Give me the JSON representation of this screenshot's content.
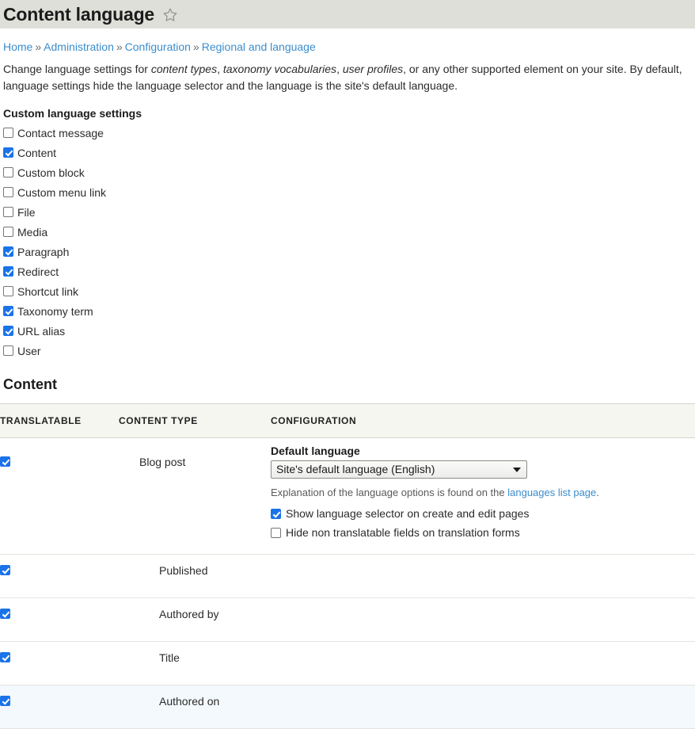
{
  "header": {
    "title": "Content language",
    "star_icon": "star-outline-icon"
  },
  "breadcrumb": {
    "separator": "»",
    "items": [
      {
        "label": "Home"
      },
      {
        "label": "Administration"
      },
      {
        "label": "Configuration"
      },
      {
        "label": "Regional and language"
      }
    ]
  },
  "intro": {
    "part1": "Change language settings for ",
    "em1": "content types",
    "part2": ", ",
    "em2": "taxonomy vocabularies",
    "part3": ", ",
    "em3": "user profiles",
    "part4": ", or any other supported element on your site. By default, language settings hide the language selector and the language is the site's default language."
  },
  "custom_language_settings": {
    "title": "Custom language settings",
    "items": [
      {
        "label": "Contact message",
        "checked": false
      },
      {
        "label": "Content",
        "checked": true
      },
      {
        "label": "Custom block",
        "checked": false
      },
      {
        "label": "Custom menu link",
        "checked": false
      },
      {
        "label": "File",
        "checked": false
      },
      {
        "label": "Media",
        "checked": false
      },
      {
        "label": "Paragraph",
        "checked": true
      },
      {
        "label": "Redirect",
        "checked": true
      },
      {
        "label": "Shortcut link",
        "checked": false
      },
      {
        "label": "Taxonomy term",
        "checked": true
      },
      {
        "label": "URL alias",
        "checked": true
      },
      {
        "label": "User",
        "checked": false
      }
    ]
  },
  "content_section": {
    "heading": "Content",
    "table": {
      "columns": [
        "TRANSLATABLE",
        "CONTENT TYPE",
        "CONFIGURATION"
      ],
      "main_row": {
        "translatable_checked": true,
        "content_type": "Blog post",
        "configuration": {
          "default_language_label": "Default language",
          "default_language_value": "Site's default language (English)",
          "help_prefix": "Explanation of the language options is found on the ",
          "help_link": "languages list page",
          "help_suffix": ".",
          "show_selector": {
            "label": "Show language selector on create and edit pages",
            "checked": true
          },
          "hide_nontranslatable": {
            "label": "Hide non translatable fields on translation forms",
            "checked": false
          }
        }
      },
      "field_rows": [
        {
          "translatable_checked": true,
          "content_type": "Published",
          "highlighted": false
        },
        {
          "translatable_checked": true,
          "content_type": "Authored by",
          "highlighted": false
        },
        {
          "translatable_checked": true,
          "content_type": "Title",
          "highlighted": false
        },
        {
          "translatable_checked": true,
          "content_type": "Authored on",
          "highlighted": true
        }
      ]
    }
  },
  "colors": {
    "header_bar": "#dfdfd9",
    "link": "#3b8dcc",
    "checkbox_checked": "#1a73e8",
    "table_header_bg": "#f6f6f1",
    "row_highlight": "#f4f9fd"
  }
}
